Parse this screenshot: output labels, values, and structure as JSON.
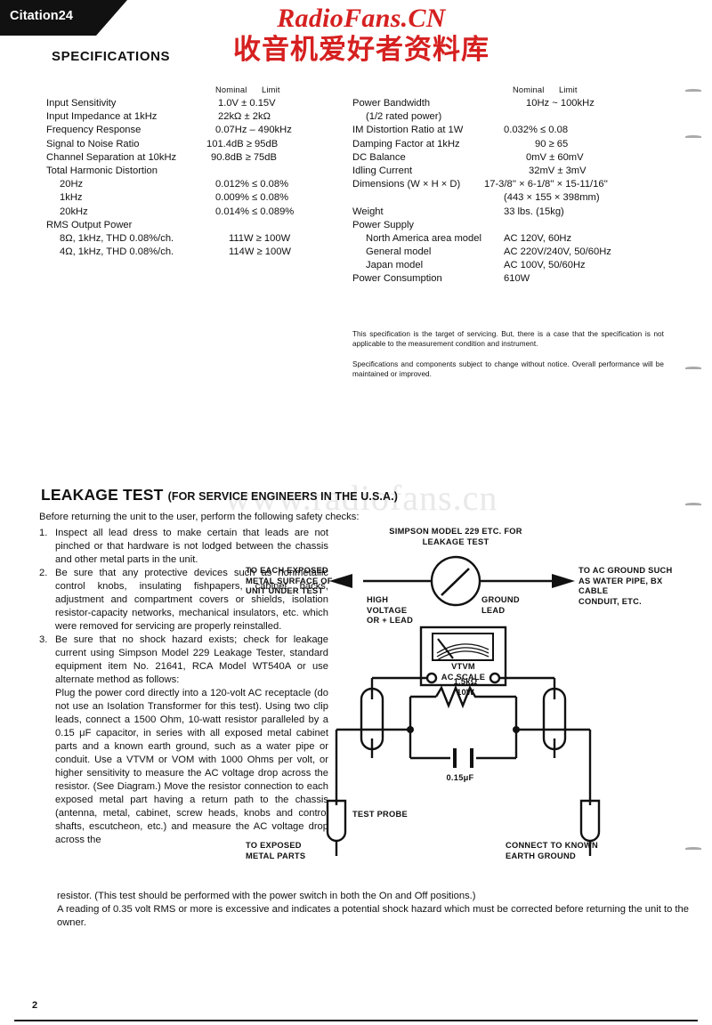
{
  "header": {
    "model_tab": "Citation24",
    "watermark_top_line1": "RadioFans.CN",
    "watermark_top_line2": "收音机爱好者资料库",
    "watermark_mid": "www.radiofans.cn"
  },
  "specifications": {
    "title": "SPECIFICATIONS",
    "col_nominal": "Nominal",
    "col_limit": "Limit",
    "left_rows": [
      {
        "name": "Input Sensitivity",
        "value": "1.0V ± 0.15V",
        "indent": 0
      },
      {
        "name": "Input Impedance at 1kHz",
        "value": "22kΩ ±  2kΩ",
        "indent": 0
      },
      {
        "name": "Frequency Response",
        "value": "0.07Hz – 490kHz",
        "indent": 0
      },
      {
        "name": "Signal to Noise Ratio",
        "value": "101.4dB ≥ 95dB",
        "indent": 0
      },
      {
        "name": "Channel Separation at 10kHz",
        "value": "90.8dB ≥ 75dB",
        "indent": 0
      },
      {
        "name": "Total Harmonic Distortion",
        "value": "",
        "indent": 0
      },
      {
        "name": "20Hz",
        "value": "0.012% ≤ 0.08%",
        "indent": 1
      },
      {
        "name": "1kHz",
        "value": "0.009% ≤ 0.08%",
        "indent": 1
      },
      {
        "name": "20kHz",
        "value": "0.014% ≤ 0.089%",
        "indent": 1
      },
      {
        "name": "RMS Output Power",
        "value": "",
        "indent": 0
      },
      {
        "name": "8Ω, 1kHz, THD 0.08%/ch.",
        "value": "111W ≥ 100W",
        "indent": 1
      },
      {
        "name": "4Ω, 1kHz, THD 0.08%/ch.",
        "value": "114W ≥ 100W",
        "indent": 1
      }
    ],
    "right_rows": [
      {
        "name": "Power Bandwidth",
        "value": "10Hz ~ 100kHz",
        "indent": 0
      },
      {
        "name": "(1/2 rated power)",
        "value": "",
        "indent": 1
      },
      {
        "name": "IM Distortion Ratio at 1W",
        "value": "0.032% ≤ 0.08",
        "indent": 0
      },
      {
        "name": "Damping Factor at 1kHz",
        "value": "90 ≥ 65",
        "indent": 0
      },
      {
        "name": "DC Balance",
        "value": "0mV ± 60mV",
        "indent": 0
      },
      {
        "name": "Idling Current",
        "value": "32mV ± 3mV",
        "indent": 0
      },
      {
        "name": "Dimensions (W × H × D)",
        "value": "17-3/8'' × 6-1/8'' × 15-11/16''",
        "indent": 0
      },
      {
        "name": "",
        "value": "(443 × 155 × 398mm)",
        "indent": 0
      },
      {
        "name": "Weight",
        "value": "33 lbs. (15kg)",
        "indent": 0
      },
      {
        "name": "Power Supply",
        "value": "",
        "indent": 0
      },
      {
        "name": "North America area model",
        "value": "AC 120V, 60Hz",
        "indent": 1
      },
      {
        "name": "General model",
        "value": "AC 220V/240V, 50/60Hz",
        "indent": 1
      },
      {
        "name": "Japan model",
        "value": "AC 100V, 50/60Hz",
        "indent": 1
      },
      {
        "name": "Power Consumption",
        "value": "610W",
        "indent": 0
      }
    ],
    "notes": [
      "This specification is the target of servicing. But, there is a case that the specification is not applicable to the measurement condition and instrument.",
      "Specifications and components subject to change without notice. Overall performance will be maintained or improved."
    ]
  },
  "leakage_test": {
    "title": "LEAKAGE TEST",
    "title_sub": "(FOR SERVICE ENGINEERS IN THE U.S.A.)",
    "intro": "Before returning the unit to the user, perform the following safety checks:",
    "items": [
      {
        "num": "1.",
        "text": "Inspect all lead dress to make certain that leads are not pinched or that hardware is not lodged between the chassis and other metal parts in the unit."
      },
      {
        "num": "2.",
        "text": "Be sure that any protective devices such as nonmetallic control knobs, insulating fishpapers, cabinet backs, adjustment and compartment covers or shields, isolation resistor-capacity networks, mechanical insulators, etc. which were removed for servicing are properly reinstalled."
      },
      {
        "num": "3.",
        "text": "Be sure that no shock hazard exists; check for leakage current using Simpson Model 229 Leakage Tester, standard equipment item No. 21641, RCA Model WT540A or use alternate method as follows:"
      },
      {
        "num": "",
        "text": "Plug the power cord directly into a 120-volt AC receptacle (do not use an Isolation Transformer for this test). Using two clip leads, connect a 1500 Ohm, 10-watt resistor paralleled by a 0.15 μF capacitor, in series with all exposed metal cabinet parts and a known earth ground, such as a water pipe or conduit. Use a VTVM or VOM with 1000 Ohms per volt, or higher sensitivity to measure the AC voltage drop across the resistor. (See Diagram.) Move the resistor connection to each exposed metal part having a return path to the chassis (antenna, metal, cabinet, screw heads, knobs and control shafts, escutcheon, etc.) and measure the AC voltage drop across the"
      }
    ],
    "tail_line1": "resistor. (This test should be performed with the power switch in both the On and Off positions.)",
    "tail_line2": "A reading of 0.35 volt RMS or more is excessive and indicates a potential shock hazard which must be corrected before returning the unit to the owner."
  },
  "diagram": {
    "meter_caption": "SIMPSON MODEL 229 ETC. FOR\nLEAKAGE TEST",
    "left_arrow_label": "TO EACH EXPOSED\nMETAL SURFACE OF\nUNIT UNDER TEST",
    "high_voltage_label": "HIGH\nVOLTAGE\nOR + LEAD",
    "ground_lead_label": "GROUND\nLEAD",
    "right_arrow_label": "TO AC GROUND SUCH\nAS WATER PIPE, BX CABLE\nCONDUIT, ETC.",
    "vtvm_label": "VTVM",
    "vtvm_scale_label": "AC SCALE",
    "resistor_label": "1.5kΩ\n10W",
    "capacitor_label": "0.15μF",
    "test_probe_label": "TEST PROBE",
    "left_probe_label": "TO EXPOSED\nMETAL PARTS",
    "right_probe_label": "CONNECT TO KNOWN\nEARTH GROUND"
  },
  "footer": {
    "page_number": "2"
  },
  "colors": {
    "watermark_red": "#d62020",
    "ink": "#111111",
    "watermark_grey": "#e9e9e9"
  }
}
